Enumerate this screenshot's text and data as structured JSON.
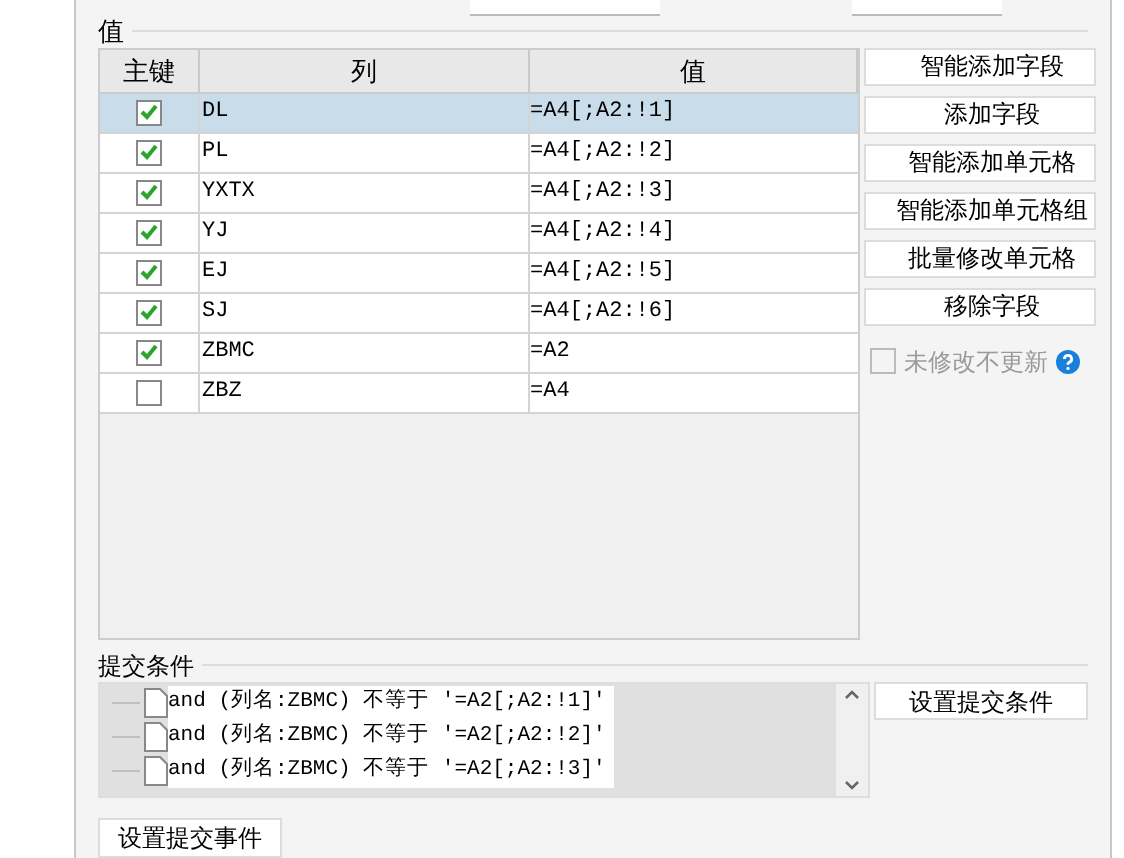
{
  "values_section": {
    "title": "值",
    "table": {
      "columns": [
        "主键",
        "列",
        "值"
      ],
      "rows": [
        {
          "key": true,
          "column": "DL",
          "value": "=A4[;A2:!1]",
          "selected": true
        },
        {
          "key": true,
          "column": "PL",
          "value": "=A4[;A2:!2]",
          "selected": false
        },
        {
          "key": true,
          "column": "YXTX",
          "value": "=A4[;A2:!3]",
          "selected": false
        },
        {
          "key": true,
          "column": "YJ",
          "value": "=A4[;A2:!4]",
          "selected": false
        },
        {
          "key": true,
          "column": "EJ",
          "value": "=A4[;A2:!5]",
          "selected": false
        },
        {
          "key": true,
          "column": "SJ",
          "value": "=A4[;A2:!6]",
          "selected": false
        },
        {
          "key": true,
          "column": "ZBMC",
          "value": "=A2",
          "selected": false
        },
        {
          "key": false,
          "column": "ZBZ",
          "value": "=A4",
          "selected": false
        }
      ]
    },
    "buttons": [
      "智能添加字段",
      "添加字段",
      "智能添加单元格",
      "智能添加单元格组",
      "批量修改单元格",
      "移除字段"
    ],
    "no_update_checkbox": {
      "label": "未修改不更新",
      "checked": false,
      "disabled": true
    }
  },
  "submit_section": {
    "title": "提交条件",
    "conditions": [
      "and (列名:ZBMC) 不等于 '=A2[;A2:!1]'",
      "and (列名:ZBMC) 不等于 '=A2[;A2:!2]'",
      "and (列名:ZBMC) 不等于 '=A2[;A2:!3]'"
    ],
    "set_condition_button": "设置提交条件"
  },
  "set_event_button": "设置提交事件"
}
